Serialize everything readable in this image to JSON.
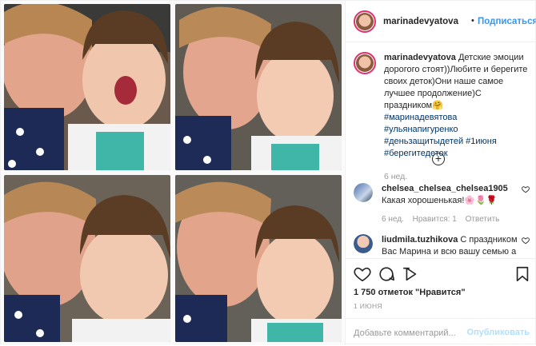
{
  "header": {
    "username": "marinadevyatova",
    "separator": "•",
    "follow_label": "Подписаться"
  },
  "caption": {
    "username": "marinadevyatova",
    "text": "Детские эмоции дорогого стоят))Любите и берегите своих деток)Они наше самое лучшее продолжение)С праздником",
    "emoji": "🤗",
    "hashtags": [
      "#маринадевятова",
      "#ульянапигуренко",
      "#деньзащитыдетей",
      "#1июня",
      "#берегитедеток"
    ],
    "time": "6 нед."
  },
  "load_more_symbol": "+",
  "comments": [
    {
      "username": "chelsea_chelsea_chelsea1905",
      "text": "Какая хорошенькая!🌸🌷🌹",
      "time": "6 нед.",
      "likes": "Нравится: 1",
      "reply": "Ответить"
    },
    {
      "username": "liudmila.tuzhikova",
      "text": "С праздником Вас Марина и всю вашу семью а"
    }
  ],
  "actions": {
    "likes_count": "1 750 отметок \"Нравится\"",
    "date": "1 ИЮНЯ"
  },
  "add_comment": {
    "placeholder": "Добавьте комментарий...",
    "publish_label": "Опубликовать"
  },
  "colors": {
    "accent": "#3897f0",
    "hashtag": "#003569",
    "muted": "#999999",
    "publish_disabled": "#b2dffc"
  },
  "icons": [
    "heart-icon",
    "comment-icon",
    "share-icon",
    "bookmark-icon",
    "small-heart-icon",
    "plus-circle-icon"
  ]
}
